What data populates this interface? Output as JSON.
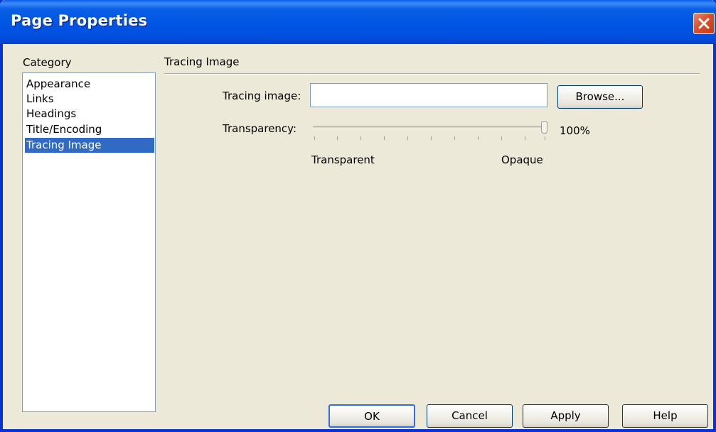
{
  "window": {
    "title": "Page Properties"
  },
  "category": {
    "label": "Category",
    "items": [
      "Appearance",
      "Links",
      "Headings",
      "Title/Encoding",
      "Tracing Image"
    ],
    "selected": "Tracing Image"
  },
  "tracing": {
    "section_title": "Tracing Image",
    "image_label": "Tracing image:",
    "image_value": "",
    "browse_label": "Browse...",
    "transparency_label": "Transparency:",
    "transparency_value": "100%",
    "transparency_fraction": 1.0,
    "slider_min_label": "Transparent",
    "slider_max_label": "Opaque"
  },
  "buttons": {
    "ok": "OK",
    "cancel": "Cancel",
    "apply": "Apply",
    "help": "Help"
  },
  "icons": {
    "close": "close-icon"
  },
  "colors": {
    "titlebar": "#0054e3",
    "selection": "#316ac5",
    "close": "#d8512d",
    "dialog_bg": "#ece9d8"
  }
}
